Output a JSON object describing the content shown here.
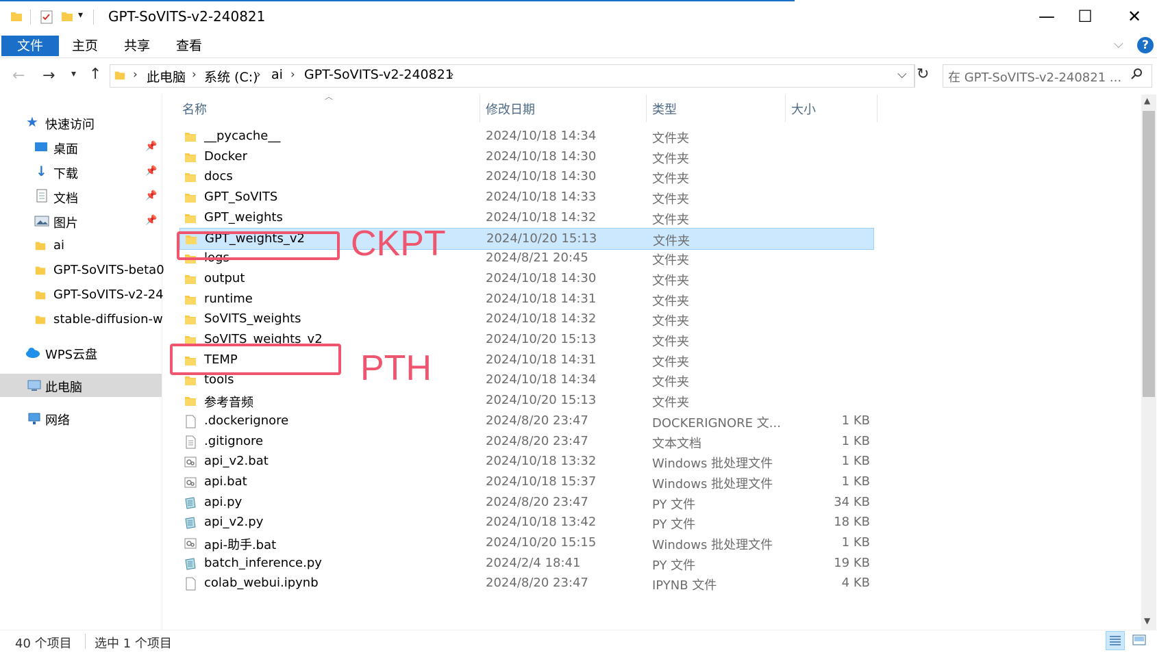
{
  "window": {
    "title": "GPT-SoVITS-v2-240821",
    "minimize": "—",
    "maximize": "☐",
    "close": "✕"
  },
  "ribbon": {
    "tabs": [
      "文件",
      "主页",
      "共享",
      "查看"
    ],
    "collapse_chevron": "chevron-down-icon",
    "help": "?"
  },
  "address": {
    "crumbs": [
      "此电脑",
      "系统 (C:)",
      "ai",
      "GPT-SoVITS-v2-240821"
    ],
    "search_placeholder": "在 GPT-SoVITS-v2-240821 ..."
  },
  "nav": {
    "quick_access": "快速访问",
    "items": [
      {
        "label": "桌面",
        "icon": "desktop-icon",
        "pinned": true
      },
      {
        "label": "下载",
        "icon": "download-icon",
        "pinned": true
      },
      {
        "label": "文档",
        "icon": "document-icon",
        "pinned": true
      },
      {
        "label": "图片",
        "icon": "pictures-icon",
        "pinned": true
      },
      {
        "label": "ai",
        "icon": "folder-icon",
        "pinned": false
      },
      {
        "label": "GPT-SoVITS-beta0",
        "icon": "folder-icon",
        "pinned": false
      },
      {
        "label": "GPT-SoVITS-v2-24",
        "icon": "folder-icon",
        "pinned": false
      },
      {
        "label": "stable-diffusion-w",
        "icon": "folder-icon",
        "pinned": false
      }
    ],
    "wps": "WPS云盘",
    "this_pc": "此电脑",
    "network": "网络"
  },
  "columns": {
    "name": "名称",
    "date": "修改日期",
    "type": "类型",
    "size": "大小"
  },
  "files": [
    {
      "name": "__pycache__",
      "date": "2024/10/18 14:34",
      "type": "文件夹",
      "size": "",
      "icon": "folder-icon"
    },
    {
      "name": "Docker",
      "date": "2024/10/18 14:30",
      "type": "文件夹",
      "size": "",
      "icon": "folder-icon"
    },
    {
      "name": "docs",
      "date": "2024/10/18 14:30",
      "type": "文件夹",
      "size": "",
      "icon": "folder-icon"
    },
    {
      "name": "GPT_SoVITS",
      "date": "2024/10/18 14:33",
      "type": "文件夹",
      "size": "",
      "icon": "folder-icon"
    },
    {
      "name": "GPT_weights",
      "date": "2024/10/18 14:32",
      "type": "文件夹",
      "size": "",
      "icon": "folder-icon"
    },
    {
      "name": "GPT_weights_v2",
      "date": "2024/10/20 15:13",
      "type": "文件夹",
      "size": "",
      "icon": "folder-icon",
      "selected": true
    },
    {
      "name": "logs",
      "date": "2024/8/21 20:45",
      "type": "文件夹",
      "size": "",
      "icon": "folder-icon"
    },
    {
      "name": "output",
      "date": "2024/10/18 14:30",
      "type": "文件夹",
      "size": "",
      "icon": "folder-icon"
    },
    {
      "name": "runtime",
      "date": "2024/10/18 14:31",
      "type": "文件夹",
      "size": "",
      "icon": "folder-icon"
    },
    {
      "name": "SoVITS_weights",
      "date": "2024/10/18 14:32",
      "type": "文件夹",
      "size": "",
      "icon": "folder-icon"
    },
    {
      "name": "SoVITS_weights_v2",
      "date": "2024/10/20 15:13",
      "type": "文件夹",
      "size": "",
      "icon": "folder-icon"
    },
    {
      "name": "TEMP",
      "date": "2024/10/18 14:31",
      "type": "文件夹",
      "size": "",
      "icon": "folder-icon"
    },
    {
      "name": "tools",
      "date": "2024/10/18 14:34",
      "type": "文件夹",
      "size": "",
      "icon": "folder-icon"
    },
    {
      "name": "参考音频",
      "date": "2024/10/20 15:13",
      "type": "文件夹",
      "size": "",
      "icon": "folder-icon"
    },
    {
      "name": ".dockerignore",
      "date": "2024/8/20 23:47",
      "type": "DOCKERIGNORE 文...",
      "size": "1 KB",
      "icon": "file-icon"
    },
    {
      "name": ".gitignore",
      "date": "2024/8/20 23:47",
      "type": "文本文档",
      "size": "1 KB",
      "icon": "text-file-icon"
    },
    {
      "name": "api_v2.bat",
      "date": "2024/10/18 13:32",
      "type": "Windows 批处理文件",
      "size": "1 KB",
      "icon": "batch-file-icon"
    },
    {
      "name": "api.bat",
      "date": "2024/10/18 15:37",
      "type": "Windows 批处理文件",
      "size": "1 KB",
      "icon": "batch-file-icon"
    },
    {
      "name": "api.py",
      "date": "2024/8/20 23:47",
      "type": "PY 文件",
      "size": "34 KB",
      "icon": "python-file-icon"
    },
    {
      "name": "api_v2.py",
      "date": "2024/10/18 13:42",
      "type": "PY 文件",
      "size": "18 KB",
      "icon": "python-file-icon"
    },
    {
      "name": "api-助手.bat",
      "date": "2024/10/20 15:15",
      "type": "Windows 批处理文件",
      "size": "1 KB",
      "icon": "batch-file-icon"
    },
    {
      "name": "batch_inference.py",
      "date": "2024/2/4 18:41",
      "type": "PY 文件",
      "size": "19 KB",
      "icon": "python-file-icon"
    },
    {
      "name": "colab_webui.ipynb",
      "date": "2024/8/20 23:47",
      "type": "IPYNB 文件",
      "size": "4 KB",
      "icon": "file-icon"
    }
  ],
  "status": {
    "count": "40 个项目",
    "selection": "选中 1 个项目"
  },
  "annotations": {
    "ckpt": "CKPT",
    "pth": "PTH",
    "color": "#f0556f"
  },
  "colors": {
    "accent": "#1a6fc9",
    "selection": "#cce8ff",
    "folder": "#f8cc4a"
  }
}
